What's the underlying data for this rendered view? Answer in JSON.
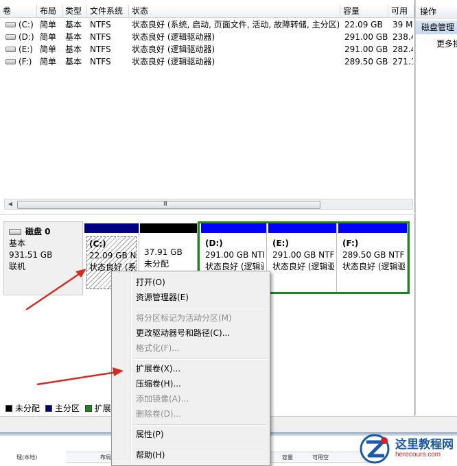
{
  "volume_table": {
    "columns": [
      "卷",
      "布局",
      "类型",
      "文件系统",
      "状态",
      "容量",
      "可用"
    ],
    "rows": [
      {
        "volume": "(C:)",
        "layout": "简单",
        "type": "基本",
        "fs": "NTFS",
        "status": "状态良好 (系统, 启动, 页面文件, 活动, 故障转储, 主分区)",
        "capacity": "22.09 GB",
        "free": "39 M"
      },
      {
        "volume": "(D:)",
        "layout": "简单",
        "type": "基本",
        "fs": "NTFS",
        "status": "状态良好 (逻辑驱动器)",
        "capacity": "291.00 GB",
        "free": "238.4"
      },
      {
        "volume": "(E:)",
        "layout": "简单",
        "type": "基本",
        "fs": "NTFS",
        "status": "状态良好 (逻辑驱动器)",
        "capacity": "291.00 GB",
        "free": "282.4"
      },
      {
        "volume": "(F:)",
        "layout": "简单",
        "type": "基本",
        "fs": "NTFS",
        "status": "状态良好 (逻辑驱动器)",
        "capacity": "289.50 GB",
        "free": "271.1"
      }
    ],
    "scroll_grip": "III"
  },
  "actions": {
    "title": "操作",
    "selected": "磁盘管理",
    "more": "更多操作"
  },
  "disk": {
    "name": "磁盘 0",
    "type": "基本",
    "size": "931.51 GB",
    "state": "联机",
    "partitions": [
      {
        "name": "(C:)",
        "size": "22.09 GB NTFS",
        "status": "状态良好 (系统, 启动)",
        "color": "#000080"
      },
      {
        "name": "",
        "size": "37.91 GB",
        "status": "未分配",
        "color": "#000000"
      },
      {
        "name": "(D:)",
        "size": "291.00 GB NTFS",
        "status": "状态良好 (逻辑驱动器)",
        "color": "#0000ff"
      },
      {
        "name": "(E:)",
        "size": "291.00 GB NTFS",
        "status": "状态良好 (逻辑驱动器)",
        "color": "#0000ff"
      },
      {
        "name": "(F:)",
        "size": "289.50 GB NTFS",
        "status": "状态良好 (逻辑驱动器)",
        "color": "#0000ff"
      }
    ]
  },
  "legend": [
    {
      "label": "未分配",
      "color": "#000000"
    },
    {
      "label": "主分区",
      "color": "#000080"
    },
    {
      "label": "扩展",
      "color": "#1b8a1b"
    }
  ],
  "context_menu": {
    "items": [
      {
        "label": "打开(O)",
        "enabled": true
      },
      {
        "label": "资源管理器(E)",
        "enabled": true
      },
      {
        "label": "将分区标记为活动分区(M)",
        "enabled": false
      },
      {
        "label": "更改驱动器号和路径(C)...",
        "enabled": true
      },
      {
        "label": "格式化(F)...",
        "enabled": false
      },
      {
        "label": "扩展卷(X)...",
        "enabled": true
      },
      {
        "label": "压缩卷(H)...",
        "enabled": true
      },
      {
        "label": "添加镜像(A)...",
        "enabled": false
      },
      {
        "label": "删除卷(D)...",
        "enabled": false
      },
      {
        "label": "属性(P)",
        "enabled": true
      },
      {
        "label": "帮助(H)",
        "enabled": true
      }
    ]
  },
  "taskbar_mini": {
    "left_label": "理(本地)",
    "cols_left": [
      "布局"
    ],
    "cols_right": [
      "容量",
      "可用空"
    ]
  },
  "watermark": {
    "text": "这里教程网",
    "url": "herecours.com"
  }
}
